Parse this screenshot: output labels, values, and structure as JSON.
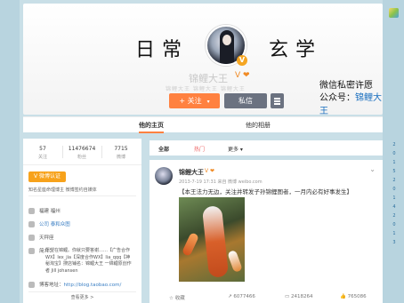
{
  "cover": {
    "title_left": "日常",
    "title_right": "玄学",
    "username": "锦鲤大王",
    "vip_icons": "V ❤",
    "bio_blur": "锦鲤大王 锦鲤大王 锦鲤大王",
    "follow_label": "+ 关注",
    "message_label": "私信",
    "note_line1": "微信私密许愿",
    "note_line2_prefix": "公众号：",
    "note_line2_highlight": "锦鲤大王"
  },
  "tabs": {
    "home": "他的主页",
    "album": "他的相册"
  },
  "stats": [
    {
      "number": "57",
      "label": "关注"
    },
    {
      "number": "11476674",
      "label": "粉丝"
    },
    {
      "number": "7715",
      "label": "微博"
    }
  ],
  "sidebar": {
    "level_badge": "V 微博认证",
    "level_note": "知名星座命理博主 微博签约自媒体",
    "location": "福建 福州",
    "company": "公司 泰和众图",
    "tags": "天秤座",
    "intro_label": "简介：",
    "intro_text": "愿望在锦鲤。你就只要答谢……【广告合作WX】lex_jia【深度合作WX】lia_qqq【神秘淘宝】搜店铺名：锦鲤大王 一锦鲤原创作者 Jill johansen",
    "blog_label": "博客地址：",
    "blog_url": "http://blog.taobao.com/",
    "view_more": "查看更多 >"
  },
  "feed_tabs": {
    "all": "全部",
    "hot": "热门",
    "more": "更多 ▾"
  },
  "post": {
    "author": "锦鲤大王",
    "badges": "V ❤",
    "meta": "2013-7-19 17:31 来自 微博 weibo.com",
    "text": "【本王法力无边，关注并转发子孙锦鲤图者，一月内必有好事发生】",
    "actions": {
      "favorite": "收藏",
      "repost": "6077466",
      "comment": "2418264",
      "like": "765086"
    }
  },
  "rail": [
    "2",
    "0",
    "1",
    "5",
    "2",
    "0",
    "1",
    "4",
    "2",
    "0",
    "1",
    "3"
  ],
  "colors": {
    "accent": "#ff8140",
    "background": "#c9dfe7",
    "link": "#3b7fc4",
    "level": "#f7a21b"
  }
}
